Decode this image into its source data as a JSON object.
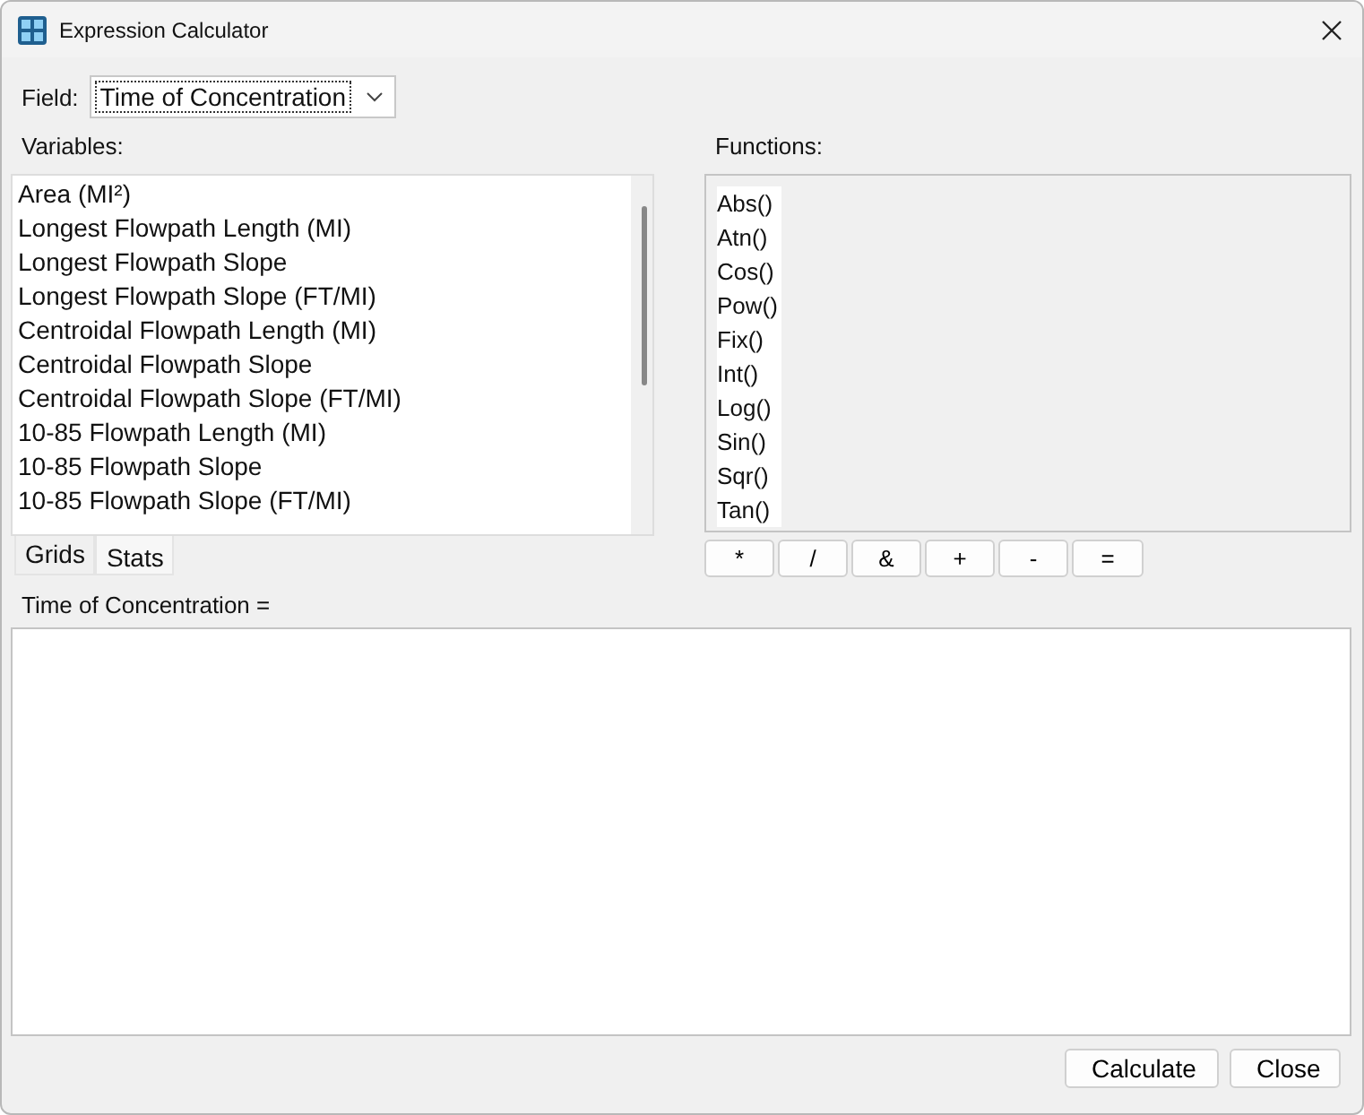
{
  "window": {
    "title": "Expression Calculator"
  },
  "field": {
    "label": "Field:",
    "value": "Time of Concentration"
  },
  "variables": {
    "label": "Variables:",
    "items": [
      "Area (MI²)",
      "Longest Flowpath Length (MI)",
      "Longest Flowpath Slope",
      "Longest Flowpath Slope (FT/MI)",
      "Centroidal Flowpath Length (MI)",
      "Centroidal Flowpath Slope",
      "Centroidal Flowpath Slope (FT/MI)",
      "10-85 Flowpath Length (MI)",
      "10-85 Flowpath Slope",
      "10-85 Flowpath Slope (FT/MI)"
    ]
  },
  "tabs": [
    {
      "label": "Grids",
      "selected": false
    },
    {
      "label": "Stats",
      "selected": true
    }
  ],
  "functions": {
    "label": "Functions:",
    "items": [
      "Abs()",
      "Atn()",
      "Cos()",
      "Pow()",
      "Fix()",
      "Int()",
      "Log()",
      "Sin()",
      "Sqr()",
      "Tan()"
    ]
  },
  "operators": [
    "*",
    "/",
    "&",
    "+",
    "-",
    "="
  ],
  "expression": {
    "label": "Time of Concentration ="
  },
  "buttons": [
    "Calculate",
    "Close"
  ]
}
